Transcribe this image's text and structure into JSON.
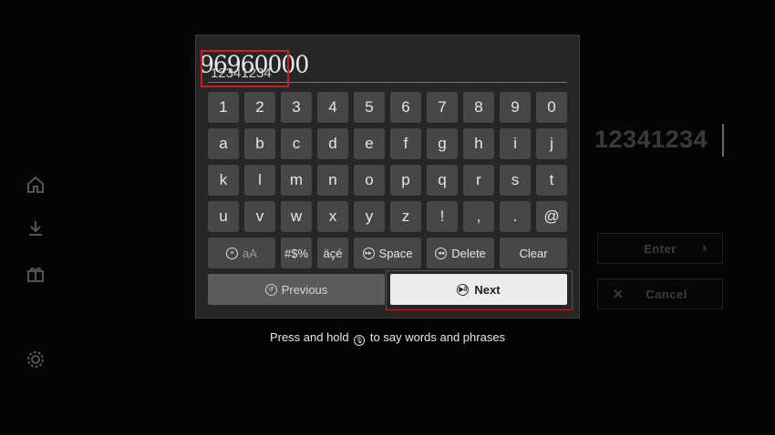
{
  "sidebar": {
    "icons": [
      "home-icon",
      "download-icon",
      "gift-icon",
      "gear-icon"
    ]
  },
  "background": {
    "value": "12341234",
    "enter_label": "Enter",
    "cancel_label": "Cancel"
  },
  "keyboard": {
    "handwritten": "96960000",
    "typed_value": "12341234",
    "rows": [
      [
        "1",
        "2",
        "3",
        "4",
        "5",
        "6",
        "7",
        "8",
        "9",
        "0"
      ],
      [
        "a",
        "b",
        "c",
        "d",
        "e",
        "f",
        "g",
        "h",
        "i",
        "j"
      ],
      [
        "k",
        "l",
        "m",
        "n",
        "o",
        "p",
        "q",
        "r",
        "s",
        "t"
      ],
      [
        "u",
        "v",
        "w",
        "x",
        "y",
        "z",
        "!",
        ",",
        ".",
        "@"
      ]
    ],
    "bottom": {
      "case_label": "aA",
      "symbols_label": "#$%",
      "accents_label": "äçé",
      "space_label": "Space",
      "delete_label": "Delete",
      "clear_label": "Clear"
    },
    "previous_label": "Previous",
    "next_label": "Next"
  },
  "hint": {
    "prefix": "Press and hold",
    "suffix": "to say words and phrases"
  },
  "colors": {
    "highlight": "#c81e1e",
    "key_bg": "#474747",
    "panel_bg": "#262626"
  }
}
